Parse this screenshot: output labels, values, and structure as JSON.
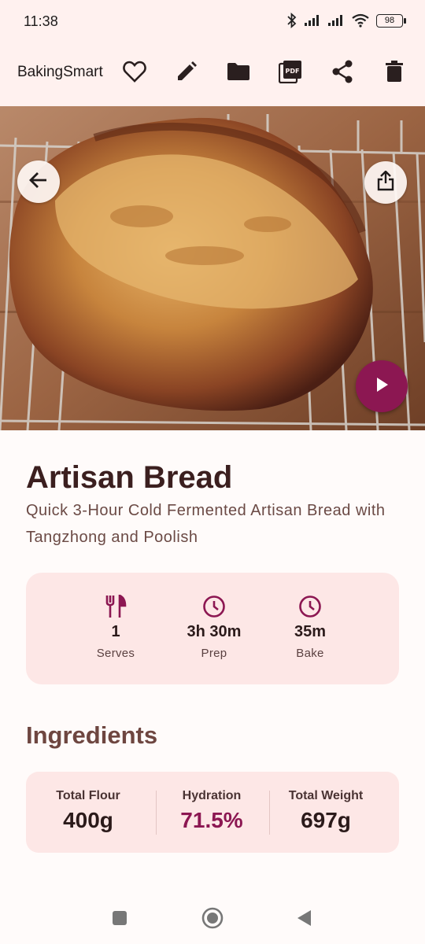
{
  "status_bar": {
    "time": "11:38",
    "battery": "98",
    "icons": [
      "bluetooth-icon",
      "signal-icon",
      "signal-icon",
      "wifi-icon",
      "battery-icon"
    ]
  },
  "app_bar": {
    "title": "BakingSmart",
    "actions": [
      "favorite-icon",
      "edit-icon",
      "folder-icon",
      "pdf-icon",
      "share-icon",
      "delete-icon"
    ],
    "pdf_label": "PDF"
  },
  "hero": {
    "image": "artisan-bread-photo",
    "back_icon": "arrow-back-icon",
    "export_icon": "export-icon",
    "play_icon": "play-icon"
  },
  "recipe": {
    "title": "Artisan Bread",
    "subtitle": "Quick 3-Hour Cold Fermented Artisan Bread with Tangzhong and Poolish"
  },
  "info": {
    "serves": {
      "value": "1",
      "label": "Serves",
      "icon": "restaurant-icon"
    },
    "prep": {
      "value": "3h 30m",
      "label": "Prep",
      "icon": "clock-icon"
    },
    "bake": {
      "value": "35m",
      "label": "Bake",
      "icon": "clock-icon"
    }
  },
  "ingredients": {
    "title": "Ingredients",
    "total_flour": {
      "label": "Total Flour",
      "value": "400g"
    },
    "hydration": {
      "label": "Hydration",
      "value": "71.5%"
    },
    "total_weight": {
      "label": "Total Weight",
      "value": "697g"
    }
  },
  "colors": {
    "accent": "#8c1752",
    "surface": "#fff1ef",
    "card": "#fde7e6",
    "title": "#3b1f1f",
    "section": "#6e4640"
  },
  "nav": [
    "recents-icon",
    "home-icon",
    "back-icon"
  ]
}
